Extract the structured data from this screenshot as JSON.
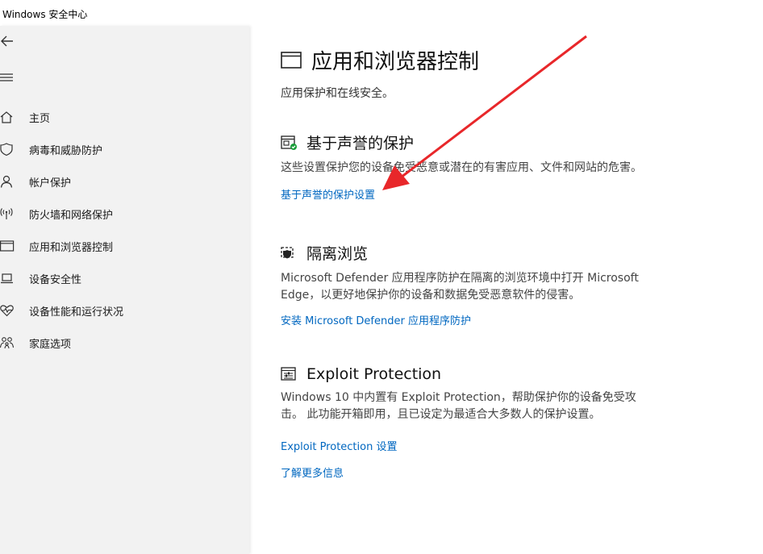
{
  "window": {
    "title": "Windows 安全中心"
  },
  "sidebar": {
    "items": [
      {
        "label": "主页",
        "icon": "home-icon"
      },
      {
        "label": "病毒和威胁防护",
        "icon": "shield-icon"
      },
      {
        "label": "帐户保护",
        "icon": "person-icon"
      },
      {
        "label": "防火墙和网络保护",
        "icon": "wifi-antenna-icon"
      },
      {
        "label": "应用和浏览器控制",
        "icon": "app-browser-icon"
      },
      {
        "label": "设备安全性",
        "icon": "laptop-icon"
      },
      {
        "label": "设备性能和运行状况",
        "icon": "heart-pulse-icon"
      },
      {
        "label": "家庭选项",
        "icon": "family-icon"
      }
    ]
  },
  "main": {
    "title": "应用和浏览器控制",
    "subtitle": "应用保护和在线安全。",
    "sections": [
      {
        "title": "基于声誉的保护",
        "description": "这些设置保护您的设备免受恶意或潜在的有害应用、文件和网站的危害。",
        "links": [
          "基于声誉的保护设置"
        ]
      },
      {
        "title": "隔离浏览",
        "description_line1": "Microsoft Defender 应用程序防护在隔离的浏览环境中打开 Microsoft",
        "description_line2": "Edge，以更好地保护你的设备和数据免受恶意软件的侵害。",
        "links": [
          "安装 Microsoft Defender 应用程序防护"
        ]
      },
      {
        "title": "Exploit Protection",
        "description_line1": "Windows 10 中内置有 Exploit Protection，帮助保护你的设备免受攻",
        "description_line2": "击。 此功能开箱即用，且已设定为最适合大多数人的保护设置。",
        "links": [
          "Exploit Protection 设置",
          "了解更多信息"
        ]
      }
    ]
  },
  "colors": {
    "link": "#0067c0",
    "arrow": "#e8272a",
    "sidebar_bg": "#f2f2f2",
    "status_ok": "#1a9e3a"
  }
}
